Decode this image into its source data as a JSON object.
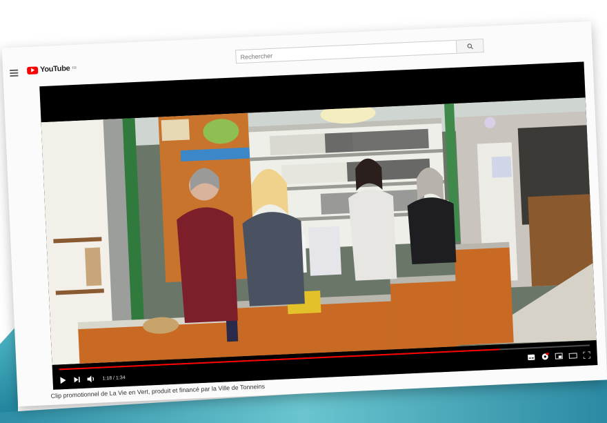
{
  "header": {
    "logo_text": "YouTube",
    "logo_region": "FR",
    "search_placeholder": "Rechercher"
  },
  "icons": {
    "menu": "menu-icon",
    "search": "search-icon",
    "play": "play-icon",
    "next": "next-icon",
    "volume": "volume-icon",
    "subtitles": "subtitles-icon",
    "settings": "settings-icon",
    "miniplayer": "miniplayer-icon",
    "theater": "theater-icon",
    "fullscreen": "fullscreen-icon"
  },
  "player": {
    "time_display": "1:18 / 1:34",
    "progress": 0.83
  },
  "video": {
    "title": "Clip promotionnel de La Vie en Vert, produit et financé par la Ville de Tonneins"
  },
  "colors": {
    "brand": "#ff0000",
    "accent_teal": "#2d8ea6"
  }
}
